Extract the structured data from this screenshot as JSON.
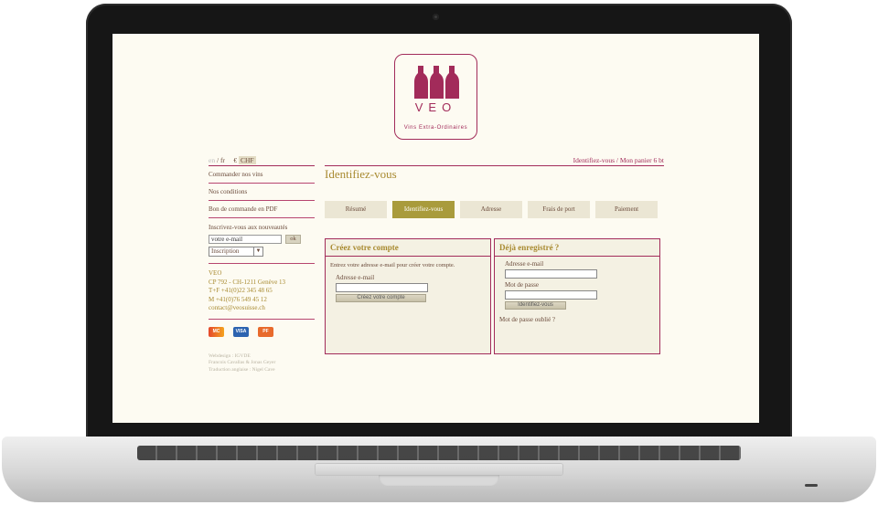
{
  "logo": {
    "name": "VEO",
    "subtitle": "Vins Extra-Ordinaires",
    "color": "#a22b5a",
    "icon": "wine-bottles-icon"
  },
  "sidebar": {
    "lang_current": "en",
    "lang_sep": " / ",
    "lang_other": "fr",
    "currency_eur": "€",
    "currency_chf": "CHF",
    "links": [
      "Commander nos vins",
      "Nos conditions",
      "Bon de commande en PDF"
    ],
    "newsletter_label": "Inscrivez-vous aux nouveautés",
    "email_placeholder": "votre e-mail",
    "ok_label": "ok",
    "select_value": "Inscription",
    "contact": [
      "VEO",
      "CP 792 - CH-1211 Genève 13",
      "T+F +41(0)22 345 48 65",
      "M +41(0)76 549 45 12",
      "contact@veosuisse.ch"
    ],
    "cards": [
      "MC",
      "VISA",
      "PF"
    ],
    "credits": [
      "Webdesign : IGVDE",
      "Francois Cavallas & Jonas Geyer",
      "Traduction anglaise : Nigel Cave"
    ]
  },
  "header": {
    "account_links": "Identifiez-vous / Mon panier 6 bt",
    "page_title": "Identifiez-vous"
  },
  "steps": [
    {
      "label": "Résumé",
      "active": false
    },
    {
      "label": "Identifiez-vous",
      "active": true
    },
    {
      "label": "Adresse",
      "active": false
    },
    {
      "label": "Frais de port",
      "active": false
    },
    {
      "label": "Paiement",
      "active": false
    }
  ],
  "create_account": {
    "title": "Créez votre compte",
    "text": "Entrez votre adresse e-mail pour créer votre compte.",
    "email_label": "Adresse e-mail",
    "button": "Créez votre compte"
  },
  "login": {
    "title": "Déjà enregistré ?",
    "email_label": "Adresse e-mail",
    "password_label": "Mot de passe",
    "button": "Identifiez-vous",
    "forgot": "Mot de passe oublié ?"
  },
  "colors": {
    "accent": "#a22b5a",
    "gold": "#a88a30",
    "screen_bg": "#fdfbf2",
    "active_step": "#a99b3c"
  }
}
